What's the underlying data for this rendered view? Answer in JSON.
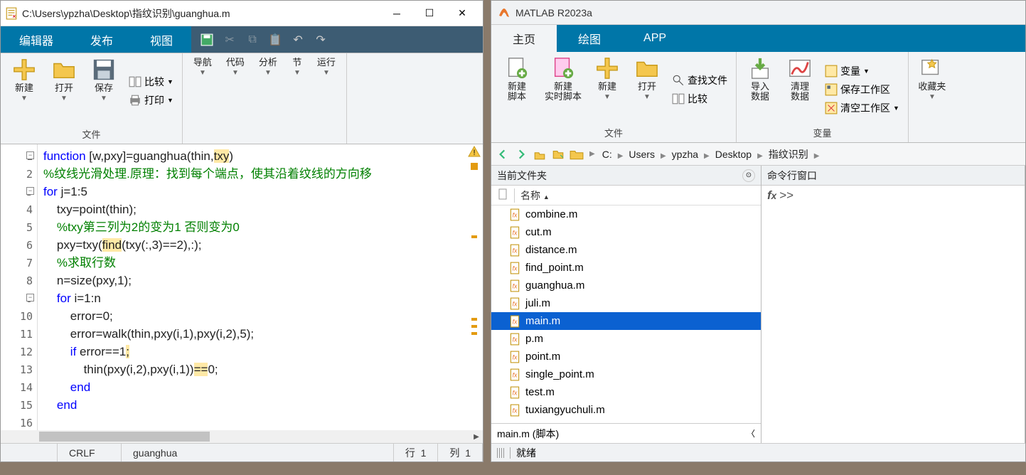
{
  "editor": {
    "title_path": "C:\\Users\\ypzha\\Desktop\\指纹识别\\guanghua.m",
    "tabs": {
      "editor": "编辑器",
      "publish": "发布",
      "view": "视图"
    },
    "ribbon": {
      "new": "新建",
      "open": "打开",
      "save": "保存",
      "compare": "比较",
      "print": "打印",
      "nav": "导航",
      "code": "代码",
      "analyze": "分析",
      "section": "节",
      "run": "运行",
      "group_file": "文件"
    },
    "code_lines": [
      {
        "n": 1,
        "html": "<span class='kw'>function</span> [w,pxy]=guanghua(thin,<span class='highlight-y'>txy</span>)"
      },
      {
        "n": 2,
        "html": "<span class='comment'>%纹线光滑处理.原理：找到每个端点，使其沿着纹线的方向移</span>"
      },
      {
        "n": 3,
        "html": "<span class='kw'>for</span> j=1:5"
      },
      {
        "n": 4,
        "html": "    txy=point(thin);"
      },
      {
        "n": 5,
        "html": "    <span class='comment'>%txy第三列为2的变为1 否则变为0</span>"
      },
      {
        "n": 6,
        "html": "    pxy=txy(<span class='highlight-y'>find</span>(txy(:,3)==2),:);"
      },
      {
        "n": 7,
        "html": "    <span class='comment'>%求取行数</span>"
      },
      {
        "n": 8,
        "html": "    n=size(pxy,1);"
      },
      {
        "n": 9,
        "html": "    <span class='kw'>for</span> i=1:n"
      },
      {
        "n": 10,
        "html": "        error=0;"
      },
      {
        "n": 11,
        "html": "        error=walk(thin,pxy(i,1),pxy(i,2),5);"
      },
      {
        "n": 12,
        "html": "        <span class='kw'>if</span> error==1<span class='highlight-y'>;</span>"
      },
      {
        "n": 13,
        "html": "            thin(pxy(i,2),pxy(i,1))<span class='highlight-y'>==</span>0;"
      },
      {
        "n": 14,
        "html": "        <span class='kw'>end</span>"
      },
      {
        "n": 15,
        "html": "    <span class='kw'>end</span>"
      },
      {
        "n": 16,
        "html": ""
      }
    ],
    "status": {
      "crlf": "CRLF",
      "fname": "guanghua",
      "row_lbl": "行",
      "row_val": "1",
      "col_lbl": "列",
      "col_val": "1"
    }
  },
  "matlab": {
    "title": "MATLAB R2023a",
    "tabs": {
      "home": "主页",
      "plot": "绘图",
      "app": "APP"
    },
    "ribbon": {
      "new_script": "新建\n脚本",
      "new_live": "新建\n实时脚本",
      "new": "新建",
      "open": "打开",
      "find_files": "查找文件",
      "compare": "比较",
      "import": "导入\n数据",
      "clear": "清理\n数据",
      "variable": "变量",
      "save_ws": "保存工作区",
      "clear_ws": "清空工作区",
      "favorites": "收藏夹",
      "group_file": "文件",
      "group_var": "变量"
    },
    "breadcrumb": [
      "C:",
      "Users",
      "ypzha",
      "Desktop",
      "指纹识别"
    ],
    "current_folder": {
      "title": "当前文件夹",
      "name_header": "名称",
      "files": [
        {
          "name": "combine.m",
          "sel": false
        },
        {
          "name": "cut.m",
          "sel": false
        },
        {
          "name": "distance.m",
          "sel": false
        },
        {
          "name": "find_point.m",
          "sel": false
        },
        {
          "name": "guanghua.m",
          "sel": false
        },
        {
          "name": "juli.m",
          "sel": false
        },
        {
          "name": "main.m",
          "sel": true
        },
        {
          "name": "p.m",
          "sel": false
        },
        {
          "name": "point.m",
          "sel": false
        },
        {
          "name": "single_point.m",
          "sel": false
        },
        {
          "name": "test.m",
          "sel": false
        },
        {
          "name": "tuxiangyuchuli.m",
          "sel": false
        }
      ],
      "detail": "main.m (脚本)"
    },
    "cmd": {
      "title": "命令行窗口",
      "prompt": ">>"
    },
    "status": "就绪"
  }
}
